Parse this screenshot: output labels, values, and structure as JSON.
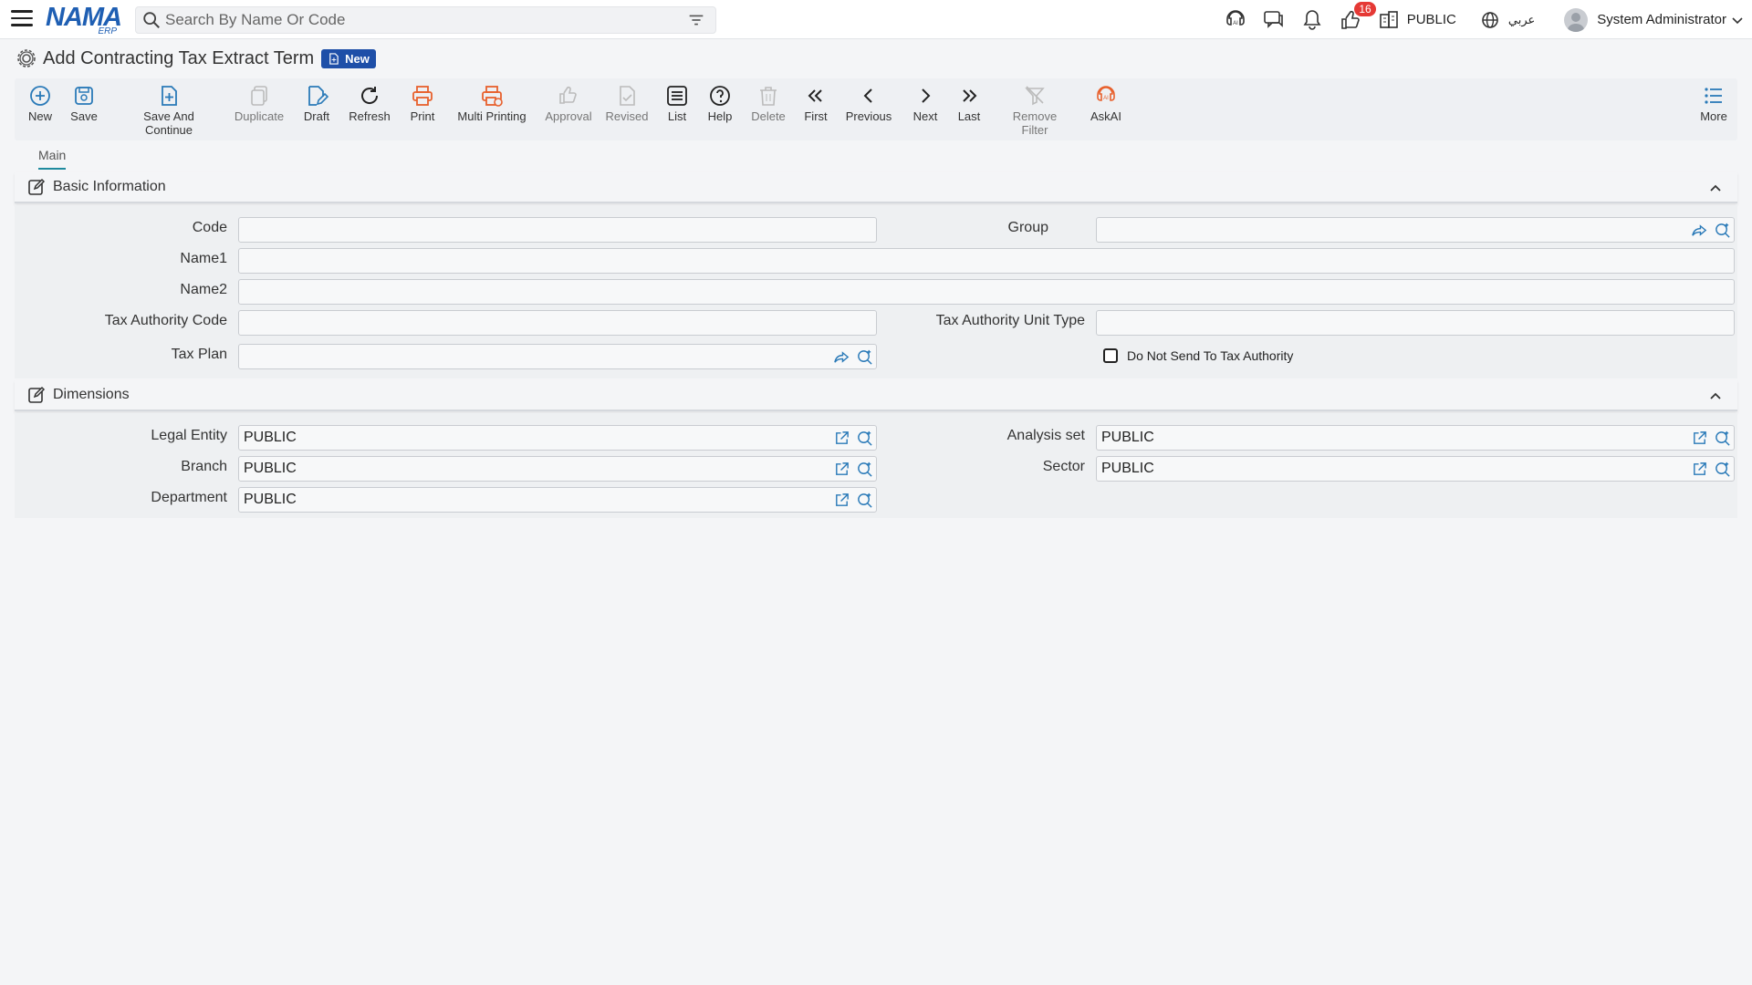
{
  "topbar": {
    "search_placeholder": "Search By Name Or Code",
    "logo_text": "NAMA",
    "logo_sub": "ERP",
    "notification_count": "16",
    "legal_entity": "PUBLIC",
    "language": "عربي",
    "user": "System Administrator"
  },
  "page": {
    "title": "Add Contracting Tax Extract Term",
    "status_badge": "New"
  },
  "toolbar": {
    "new": "New",
    "save": "Save",
    "save_continue": "Save And Continue",
    "duplicate": "Duplicate",
    "draft": "Draft",
    "refresh": "Refresh",
    "print": "Print",
    "multi_printing": "Multi Printing",
    "approval": "Approval",
    "revised": "Revised",
    "list": "List",
    "help": "Help",
    "delete": "Delete",
    "first": "First",
    "previous": "Previous",
    "next": "Next",
    "last": "Last",
    "remove_filter": "Remove Filter",
    "askai": "AskAI",
    "more": "More"
  },
  "tabs": [
    "Main"
  ],
  "basic_info": {
    "title": "Basic Information",
    "code_label": "Code",
    "code_value": "",
    "group_label": "Group",
    "group_value": "",
    "name1_label": "Name1",
    "name1_value": "",
    "name2_label": "Name2",
    "name2_value": "",
    "tax_authority_code_label": "Tax Authority Code",
    "tax_authority_code_value": "",
    "tax_authority_unit_type_label": "Tax Authority Unit Type",
    "tax_authority_unit_type_value": "",
    "tax_plan_label": "Tax Plan",
    "tax_plan_value": "",
    "do_not_send_label": "Do Not Send To Tax Authority",
    "do_not_send_checked": false
  },
  "dimensions": {
    "title": "Dimensions",
    "legal_entity_label": "Legal Entity",
    "legal_entity_value": "PUBLIC",
    "analysis_set_label": "Analysis set",
    "analysis_set_value": "PUBLIC",
    "branch_label": "Branch",
    "branch_value": "PUBLIC",
    "sector_label": "Sector",
    "sector_value": "PUBLIC",
    "department_label": "Department",
    "department_value": "PUBLIC"
  },
  "colors": {
    "brand": "#1f5fb3",
    "primary_icon": "#2a7ab8",
    "print_icon": "#e8602c",
    "badge_red": "#e53935",
    "new_badge": "#1e4fa8"
  }
}
